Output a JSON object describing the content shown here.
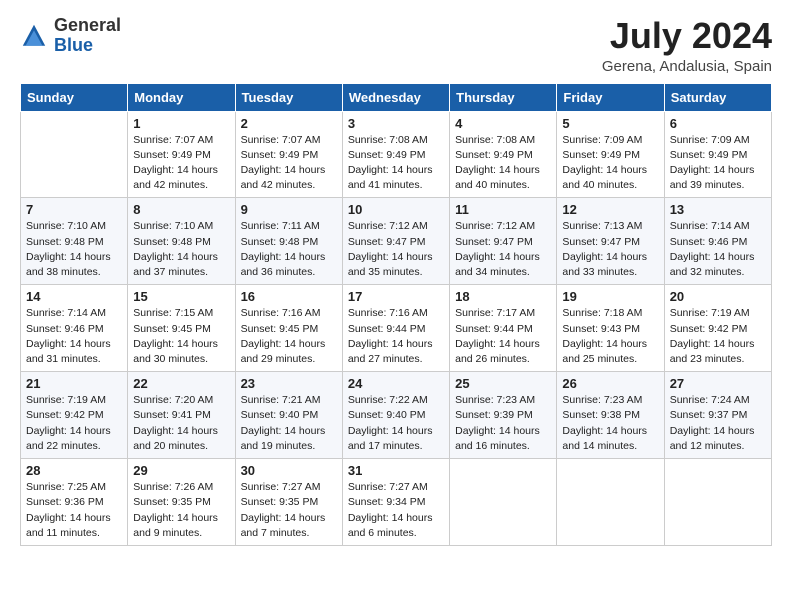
{
  "header": {
    "logo_general": "General",
    "logo_blue": "Blue",
    "month_title": "July 2024",
    "location": "Gerena, Andalusia, Spain"
  },
  "weekdays": [
    "Sunday",
    "Monday",
    "Tuesday",
    "Wednesday",
    "Thursday",
    "Friday",
    "Saturday"
  ],
  "weeks": [
    [
      {
        "day": "",
        "info": ""
      },
      {
        "day": "1",
        "info": "Sunrise: 7:07 AM\nSunset: 9:49 PM\nDaylight: 14 hours\nand 42 minutes."
      },
      {
        "day": "2",
        "info": "Sunrise: 7:07 AM\nSunset: 9:49 PM\nDaylight: 14 hours\nand 42 minutes."
      },
      {
        "day": "3",
        "info": "Sunrise: 7:08 AM\nSunset: 9:49 PM\nDaylight: 14 hours\nand 41 minutes."
      },
      {
        "day": "4",
        "info": "Sunrise: 7:08 AM\nSunset: 9:49 PM\nDaylight: 14 hours\nand 40 minutes."
      },
      {
        "day": "5",
        "info": "Sunrise: 7:09 AM\nSunset: 9:49 PM\nDaylight: 14 hours\nand 40 minutes."
      },
      {
        "day": "6",
        "info": "Sunrise: 7:09 AM\nSunset: 9:49 PM\nDaylight: 14 hours\nand 39 minutes."
      }
    ],
    [
      {
        "day": "7",
        "info": "Sunrise: 7:10 AM\nSunset: 9:48 PM\nDaylight: 14 hours\nand 38 minutes."
      },
      {
        "day": "8",
        "info": "Sunrise: 7:10 AM\nSunset: 9:48 PM\nDaylight: 14 hours\nand 37 minutes."
      },
      {
        "day": "9",
        "info": "Sunrise: 7:11 AM\nSunset: 9:48 PM\nDaylight: 14 hours\nand 36 minutes."
      },
      {
        "day": "10",
        "info": "Sunrise: 7:12 AM\nSunset: 9:47 PM\nDaylight: 14 hours\nand 35 minutes."
      },
      {
        "day": "11",
        "info": "Sunrise: 7:12 AM\nSunset: 9:47 PM\nDaylight: 14 hours\nand 34 minutes."
      },
      {
        "day": "12",
        "info": "Sunrise: 7:13 AM\nSunset: 9:47 PM\nDaylight: 14 hours\nand 33 minutes."
      },
      {
        "day": "13",
        "info": "Sunrise: 7:14 AM\nSunset: 9:46 PM\nDaylight: 14 hours\nand 32 minutes."
      }
    ],
    [
      {
        "day": "14",
        "info": "Sunrise: 7:14 AM\nSunset: 9:46 PM\nDaylight: 14 hours\nand 31 minutes."
      },
      {
        "day": "15",
        "info": "Sunrise: 7:15 AM\nSunset: 9:45 PM\nDaylight: 14 hours\nand 30 minutes."
      },
      {
        "day": "16",
        "info": "Sunrise: 7:16 AM\nSunset: 9:45 PM\nDaylight: 14 hours\nand 29 minutes."
      },
      {
        "day": "17",
        "info": "Sunrise: 7:16 AM\nSunset: 9:44 PM\nDaylight: 14 hours\nand 27 minutes."
      },
      {
        "day": "18",
        "info": "Sunrise: 7:17 AM\nSunset: 9:44 PM\nDaylight: 14 hours\nand 26 minutes."
      },
      {
        "day": "19",
        "info": "Sunrise: 7:18 AM\nSunset: 9:43 PM\nDaylight: 14 hours\nand 25 minutes."
      },
      {
        "day": "20",
        "info": "Sunrise: 7:19 AM\nSunset: 9:42 PM\nDaylight: 14 hours\nand 23 minutes."
      }
    ],
    [
      {
        "day": "21",
        "info": "Sunrise: 7:19 AM\nSunset: 9:42 PM\nDaylight: 14 hours\nand 22 minutes."
      },
      {
        "day": "22",
        "info": "Sunrise: 7:20 AM\nSunset: 9:41 PM\nDaylight: 14 hours\nand 20 minutes."
      },
      {
        "day": "23",
        "info": "Sunrise: 7:21 AM\nSunset: 9:40 PM\nDaylight: 14 hours\nand 19 minutes."
      },
      {
        "day": "24",
        "info": "Sunrise: 7:22 AM\nSunset: 9:40 PM\nDaylight: 14 hours\nand 17 minutes."
      },
      {
        "day": "25",
        "info": "Sunrise: 7:23 AM\nSunset: 9:39 PM\nDaylight: 14 hours\nand 16 minutes."
      },
      {
        "day": "26",
        "info": "Sunrise: 7:23 AM\nSunset: 9:38 PM\nDaylight: 14 hours\nand 14 minutes."
      },
      {
        "day": "27",
        "info": "Sunrise: 7:24 AM\nSunset: 9:37 PM\nDaylight: 14 hours\nand 12 minutes."
      }
    ],
    [
      {
        "day": "28",
        "info": "Sunrise: 7:25 AM\nSunset: 9:36 PM\nDaylight: 14 hours\nand 11 minutes."
      },
      {
        "day": "29",
        "info": "Sunrise: 7:26 AM\nSunset: 9:35 PM\nDaylight: 14 hours\nand 9 minutes."
      },
      {
        "day": "30",
        "info": "Sunrise: 7:27 AM\nSunset: 9:35 PM\nDaylight: 14 hours\nand 7 minutes."
      },
      {
        "day": "31",
        "info": "Sunrise: 7:27 AM\nSunset: 9:34 PM\nDaylight: 14 hours\nand 6 minutes."
      },
      {
        "day": "",
        "info": ""
      },
      {
        "day": "",
        "info": ""
      },
      {
        "day": "",
        "info": ""
      }
    ]
  ]
}
